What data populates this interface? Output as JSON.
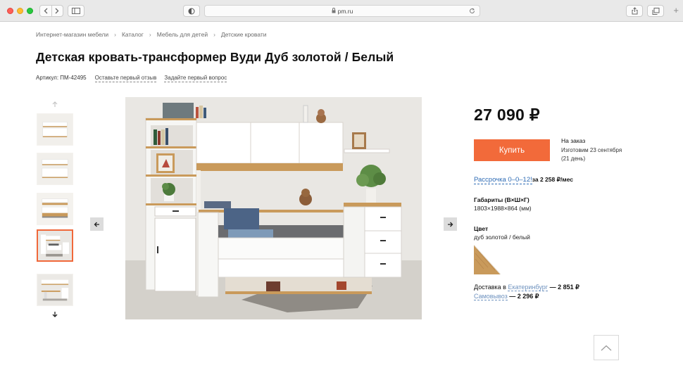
{
  "browser": {
    "url": "pm.ru",
    "icons": [
      "back-icon",
      "forward-icon",
      "sidebar-icon",
      "privacy-icon",
      "lock-icon",
      "reload-icon",
      "share-icon",
      "tabs-icon",
      "new-tab-icon"
    ]
  },
  "breadcrumb": [
    "Интернет-магазин мебели",
    "Каталог",
    "Мебель для детей",
    "Детские кровати"
  ],
  "breadcrumb_sep": "›",
  "product": {
    "title": "Детская кровать-трансформер Вуди Дуб золотой / Белый",
    "sku": "Артикул: ПМ-42495",
    "review_link": "Оставьте первый отзыв",
    "question_link": "Задайте первый вопрос"
  },
  "gallery": {
    "thumbnail_count": 5,
    "active_index": 3,
    "icons": [
      "arrow-up-icon",
      "arrow-down-icon",
      "arrow-left-icon",
      "arrow-right-icon"
    ]
  },
  "purchase": {
    "price": "27 090 ₽",
    "buy_label": "Купить",
    "status": "На заказ",
    "make_date": "Изготовим 23 сентября",
    "make_days": "(21 день)",
    "installment_link": "Рассрочка 0–0–12!",
    "installment_text": "за 2 258 ₽/мес"
  },
  "specs": {
    "dims_label": "Габариты (В×Ш×Г)",
    "dims_value": "1803×1988×864 (мм)",
    "color_label": "Цвет",
    "color_value": "дуб золотой / белый"
  },
  "delivery": {
    "prefix": "Доставка в ",
    "city": "Екатеринбург",
    "city_price": " — 2 851 ₽",
    "pickup": "Самовывоз",
    "pickup_price": " — 2 296 ₽"
  },
  "colors": {
    "accent": "#f26a3a",
    "link": "#2f6cb5",
    "oak": "#c99a5b",
    "white": "#ffffff"
  }
}
